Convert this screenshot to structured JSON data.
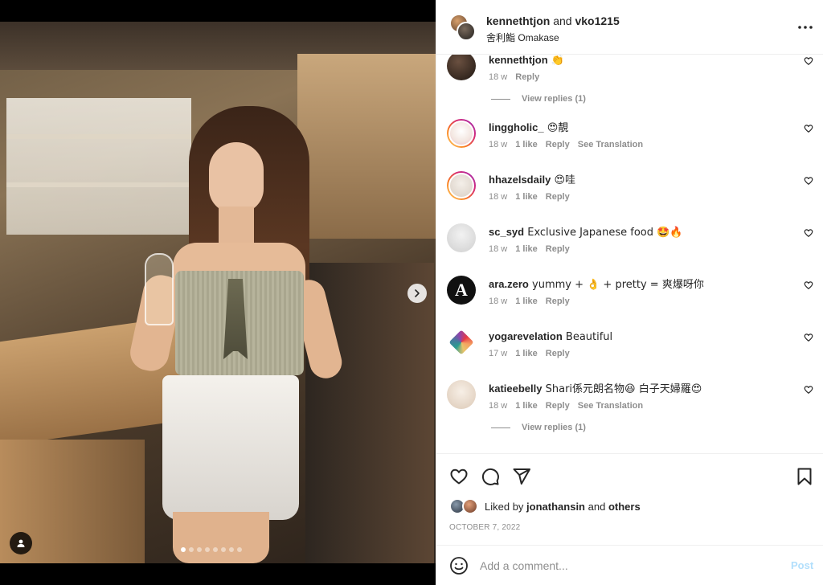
{
  "post": {
    "header": {
      "user1": "kennethtjon",
      "and_text": "and",
      "user2": "vko1215",
      "location": "舍利鮨 Omakase"
    },
    "carousel": {
      "total_slides": 8,
      "active_slide": 1
    }
  },
  "comments": [
    {
      "username": "kennethtjon",
      "text": "👏",
      "time": "18 w",
      "likes": "",
      "reply": "Reply",
      "translation": "",
      "view_replies": "View replies (1)"
    },
    {
      "username": "linggholic_",
      "text": "😍靚",
      "time": "18 w",
      "likes": "1 like",
      "reply": "Reply",
      "translation": "See Translation",
      "view_replies": ""
    },
    {
      "username": "hhazelsdaily",
      "text": "😍哇",
      "time": "18 w",
      "likes": "1 like",
      "reply": "Reply",
      "translation": "",
      "view_replies": ""
    },
    {
      "username": "sc_syd",
      "text": "Exclusive Japanese food 🤩🔥",
      "time": "18 w",
      "likes": "1 like",
      "reply": "Reply",
      "translation": "",
      "view_replies": ""
    },
    {
      "username": "ara.zero",
      "text": "yummy + 👌 + pretty = 爽爆呀你",
      "time": "18 w",
      "likes": "1 like",
      "reply": "Reply",
      "translation": "",
      "view_replies": ""
    },
    {
      "username": "yogarevelation",
      "text": "Beautiful",
      "time": "17 w",
      "likes": "1 like",
      "reply": "Reply",
      "translation": "",
      "view_replies": ""
    },
    {
      "username": "katieebelly",
      "text": "Shari係元朗名物😆 白子天婦羅😍",
      "time": "18 w",
      "likes": "1 like",
      "reply": "Reply",
      "translation": "See Translation",
      "view_replies": "View replies (1)"
    }
  ],
  "likes": {
    "prefix": "Liked by",
    "user": "jonathansin",
    "and_text": "and",
    "others": "others"
  },
  "date": "OCTOBER 7, 2022",
  "add_comment": {
    "placeholder": "Add a comment...",
    "post_label": "Post"
  },
  "icons": {
    "more": "more-horizontal-icon",
    "like": "heart-icon",
    "comment": "comment-icon",
    "share": "send-icon",
    "save": "bookmark-icon",
    "emoji": "smiley-icon",
    "next": "chevron-right-icon",
    "tags": "user-tag-icon"
  },
  "colors": {
    "text": "#262626",
    "muted": "#8e8e8e",
    "post_disabled": "#b2dffc",
    "story_ring": "#d62976"
  }
}
